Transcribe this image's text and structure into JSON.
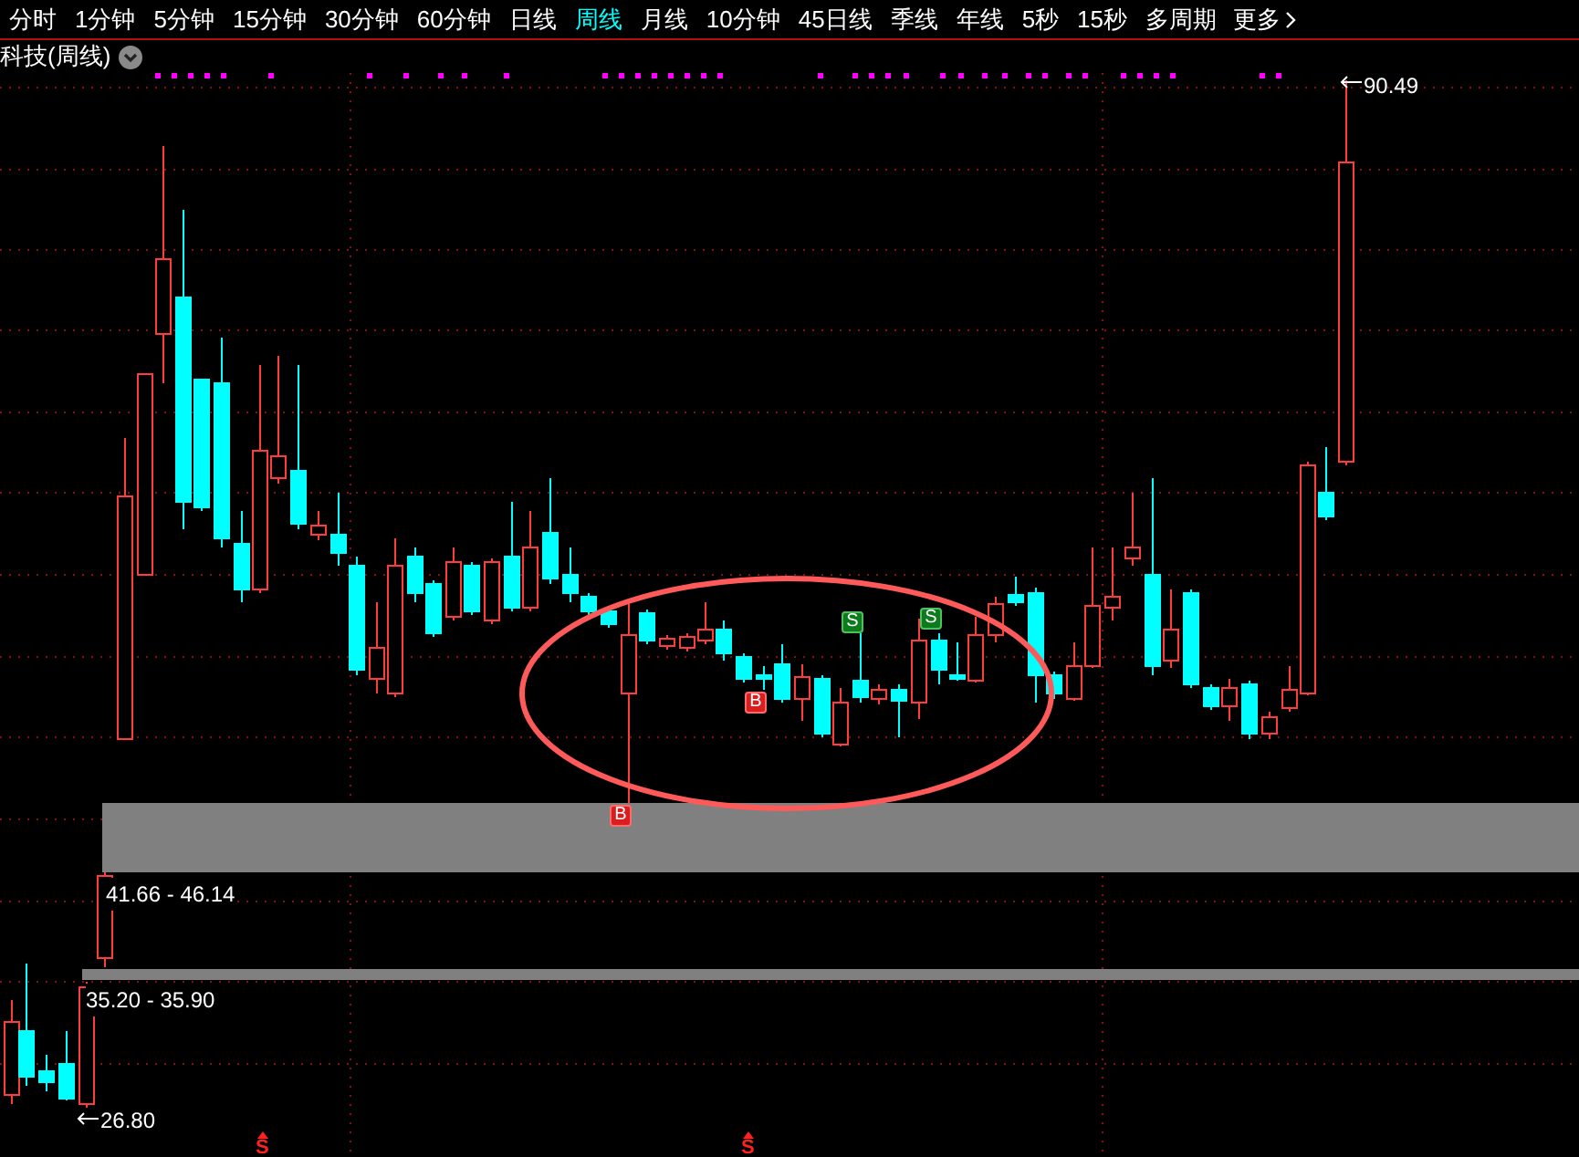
{
  "tabs": [
    {
      "label": "分时",
      "selected": false
    },
    {
      "label": "1分钟",
      "selected": false
    },
    {
      "label": "5分钟",
      "selected": false
    },
    {
      "label": "15分钟",
      "selected": false
    },
    {
      "label": "30分钟",
      "selected": false
    },
    {
      "label": "60分钟",
      "selected": false
    },
    {
      "label": "日线",
      "selected": false
    },
    {
      "label": "周线",
      "selected": true
    },
    {
      "label": "月线",
      "selected": false
    },
    {
      "label": "10分钟",
      "selected": false
    },
    {
      "label": "45日线",
      "selected": false
    },
    {
      "label": "季线",
      "selected": false
    },
    {
      "label": "年线",
      "selected": false
    },
    {
      "label": "5秒",
      "selected": false
    },
    {
      "label": "15秒",
      "selected": false
    },
    {
      "label": "多周期",
      "selected": false
    }
  ],
  "more": "更多",
  "title": "科技(周线)",
  "price_labels": {
    "high": "90.49",
    "low": "26.80"
  },
  "zones": [
    {
      "label": "41.66 - 46.14"
    },
    {
      "label": "35.20 - 35.90"
    }
  ],
  "signals": [
    {
      "kind": "buy",
      "text": "B"
    },
    {
      "kind": "buy",
      "text": "B"
    },
    {
      "kind": "sell",
      "text": "S"
    },
    {
      "kind": "sell",
      "text": "S"
    }
  ],
  "bottom_marks": [
    {
      "text": "S"
    },
    {
      "text": "S"
    }
  ]
}
